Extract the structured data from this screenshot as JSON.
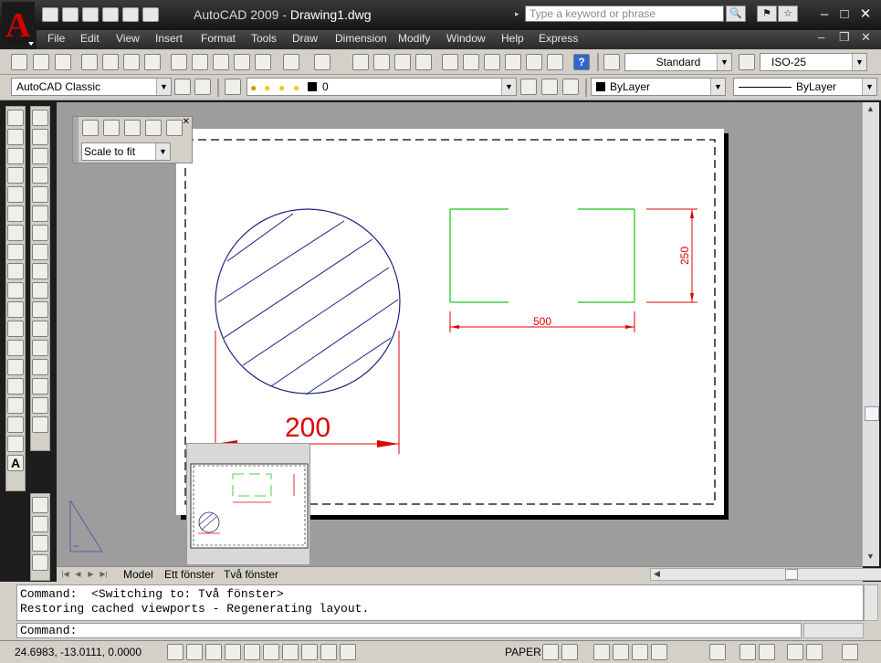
{
  "window": {
    "app_name": "AutoCAD 2009 - ",
    "document": "Drawing1.dwg",
    "search_placeholder": "Type a keyword or phrase",
    "app_letter": "A"
  },
  "menu": [
    "File",
    "Edit",
    "View",
    "Insert",
    "Format",
    "Tools",
    "Draw",
    "Dimension",
    "Modify",
    "Window",
    "Help",
    "Express"
  ],
  "toolbar": {
    "text_style": "Standard",
    "dim_style": "ISO-25"
  },
  "properties_bar": {
    "workspace": "AutoCAD Classic",
    "layer": "0",
    "color": "ByLayer",
    "linetype": "ByLayer"
  },
  "viewport_toolbar": {
    "scale": "Scale to fit"
  },
  "drawing": {
    "dim_circle": "200",
    "dim_rect_width": "500",
    "dim_rect_height": "250"
  },
  "layout_tabs": [
    "Model",
    "Ett fönster",
    "Två fönster"
  ],
  "command": {
    "history": [
      "Command:  <Switching to: Två fönster>",
      "Restoring cached viewports - Regenerating layout."
    ],
    "prompt": "Command:"
  },
  "status": {
    "coords": "24.6983, -13.0111, 0.0000",
    "space": "PAPER"
  },
  "colors": {
    "dimension": "#e00000",
    "circle": "#1a237e",
    "rectangle": "#19c319"
  }
}
